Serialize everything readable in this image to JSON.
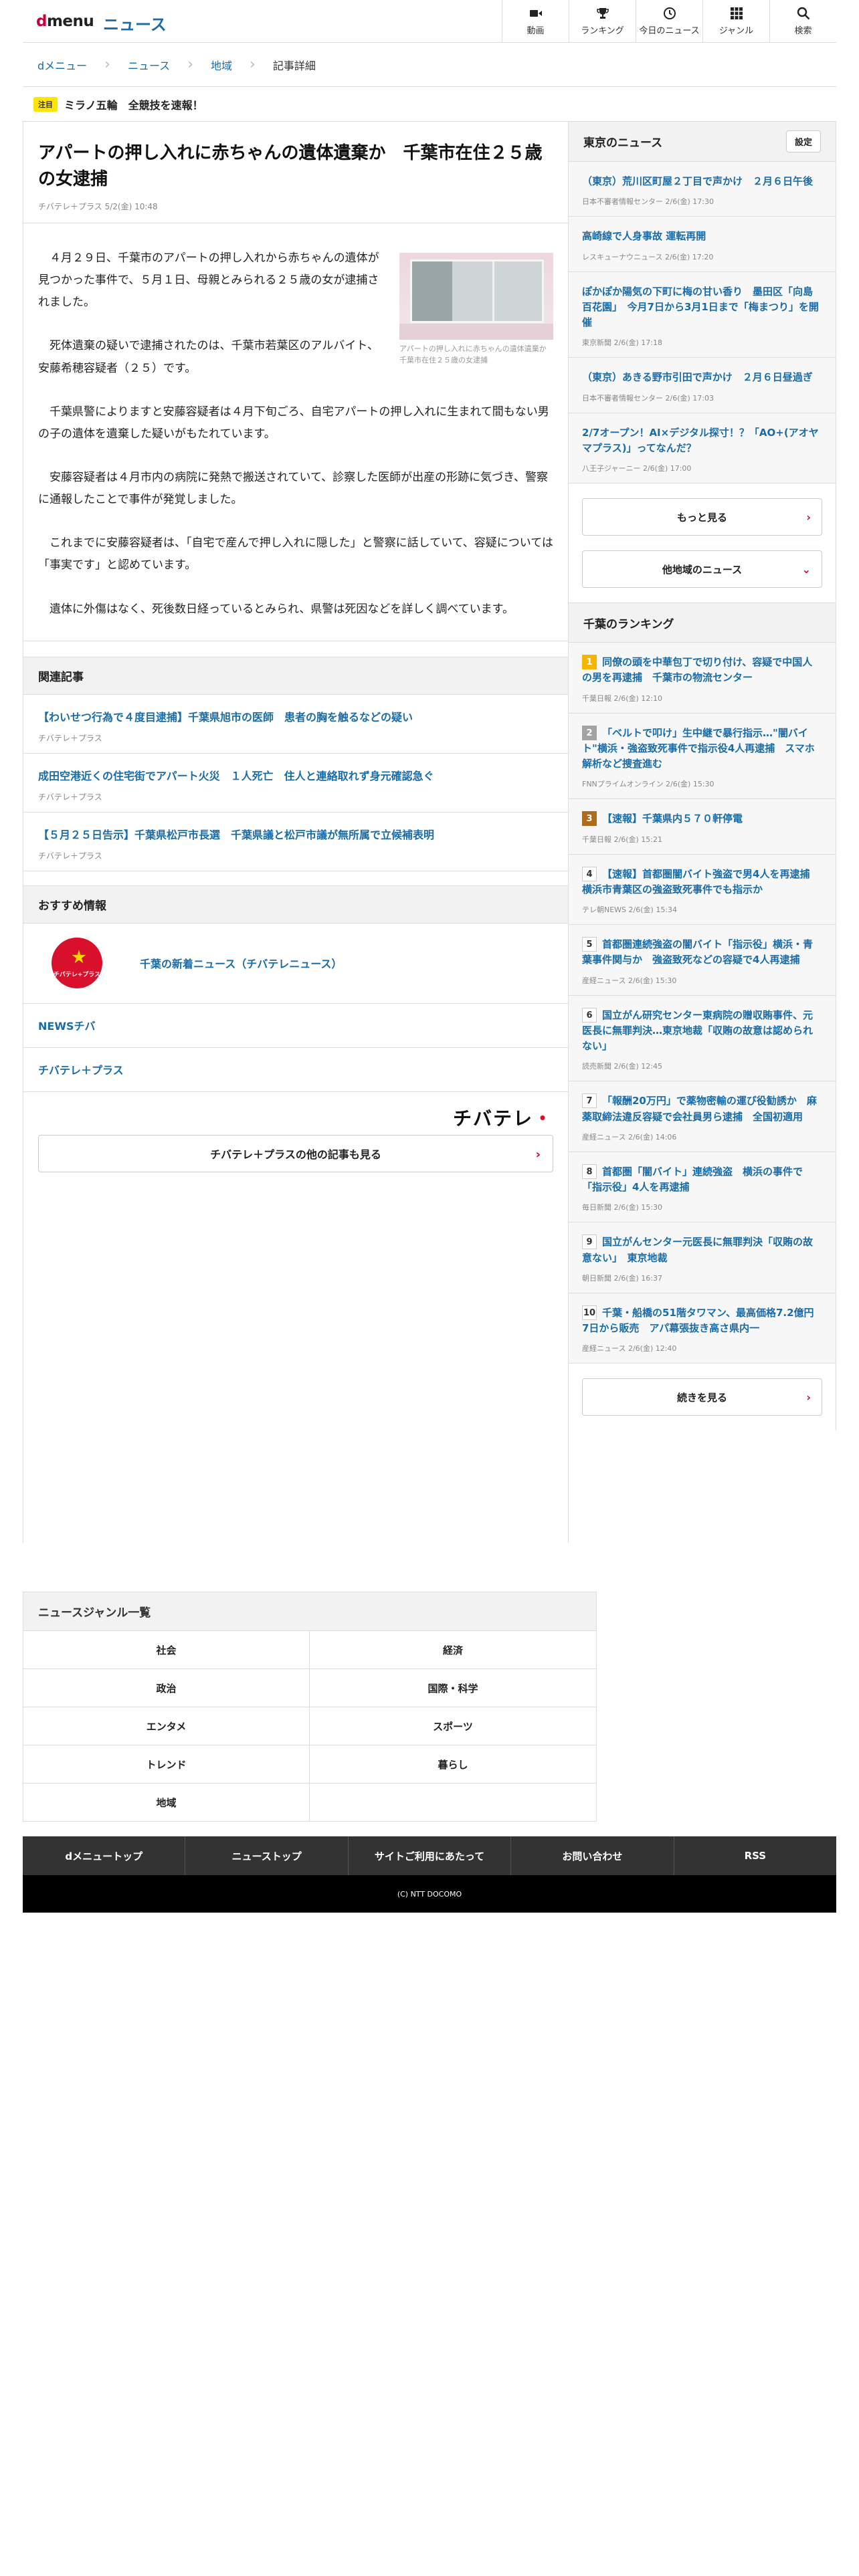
{
  "header": {
    "logo_text": "dmenu",
    "section": "ニュース",
    "nav": [
      {
        "icon": "video-camera-icon",
        "label": "動画"
      },
      {
        "icon": "trophy-icon",
        "label": "ランキング"
      },
      {
        "icon": "clock-icon",
        "label": "今日のニュース"
      },
      {
        "icon": "grid-icon",
        "label": "ジャンル"
      },
      {
        "icon": "search-icon",
        "label": "検索"
      }
    ]
  },
  "breadcrumb": [
    "dメニュー",
    "ニュース",
    "地域",
    "記事詳細"
  ],
  "notice": {
    "badge": "注目",
    "text": "ミラノ五輪　全競技を速報！"
  },
  "article": {
    "title": "アパートの押し入れに赤ちゃんの遺体遺棄か　千葉市在住２５歳の女逮捕",
    "meta": "チバテレ＋プラス 5/2(金) 10:48",
    "image_caption": "アパートの押し入れに赤ちゃんの遺体遺棄か　千葉市在住２５歳の女逮捕",
    "paragraphs": [
      "４月２９日、千葉市のアパートの押し入れから赤ちゃんの遺体が見つかった事件で、５月１日、母親とみられる２５歳の女が逮捕されました。",
      "死体遺棄の疑いで逮捕されたのは、千葉市若葉区のアルバイト、安藤希穂容疑者（２５）です。",
      "千葉県警によりますと安藤容疑者は４月下旬ごろ、自宅アパートの押し入れに生まれて間もない男の子の遺体を遺棄した疑いがもたれています。",
      "安藤容疑者は４月市内の病院に発熱で搬送されていて、診察した医師が出産の形跡に気づき、警察に通報したことで事件が発覚しました。",
      "これまでに安藤容疑者は、「自宅で産んで押し入れに隠した」と警察に話していて、容疑については「事実です」と認めています。",
      "遺体に外傷はなく、死後数日経っているとみられ、県警は死因などを詳しく調べています。"
    ]
  },
  "related": {
    "heading": "関連記事",
    "items": [
      {
        "title": "【わいせつ行為で４度目逮捕】千葉県旭市の医師　患者の胸を触るなどの疑い",
        "source": "チバテレ＋プラス"
      },
      {
        "title": "成田空港近くの住宅街でアパート火災　１人死亡　住人と連絡取れず身元確認急ぐ",
        "source": "チバテレ＋プラス"
      },
      {
        "title": "【５月２５日告示】千葉県松戸市長選　千葉県議と松戸市議が無所属で立候補表明",
        "source": "チバテレ＋プラス"
      }
    ]
  },
  "recommend": {
    "heading": "おすすめ情報",
    "logo_text": "チバテレ+プラス",
    "featured": "千葉の新着ニュース（チバテレニュース）",
    "items": [
      "NEWSチバ",
      "チバテレ＋プラス"
    ],
    "brand": "チバテレ",
    "more": "チバテレ＋プラスの他の記事も見る"
  },
  "tokyo": {
    "heading": "東京のニュース",
    "setting": "設定",
    "items": [
      {
        "title": "（東京）荒川区町屋２丁目で声かけ　２月６日午後",
        "source": "日本不審者情報センター 2/6(金) 17:30"
      },
      {
        "title": "高崎線で人身事故 運転再開",
        "source": "レスキューナウニュース 2/6(金) 17:20"
      },
      {
        "title": "ぽかぽか陽気の下町に梅の甘い香り　墨田区「向島百花園」　今月7日から3月1日まで「梅まつり」を開催",
        "source": "東京新聞 2/6(金) 17:18"
      },
      {
        "title": "（東京）あきる野市引田で声かけ　２月６日昼過ぎ",
        "source": "日本不審者情報センター 2/6(金) 17:03"
      },
      {
        "title": "2/7オープン！AI×デジタル探寸！？「AO+(アオヤマプラス)」ってなんだ？",
        "source": "八王子ジャーニー 2/6(金) 17:00"
      }
    ],
    "more": "もっと見る",
    "other": "他地域のニュース"
  },
  "ranking": {
    "heading": "千葉のランキング",
    "items": [
      {
        "rank": "1",
        "title": "同僚の頭を中華包丁で切り付け、容疑で中国人の男を再逮捕　千葉市の物流センター",
        "source": "千葉日報 2/6(金) 12:10"
      },
      {
        "rank": "2",
        "title": "「ベルトで叩け」生中継で暴行指示…\"闇バイト\"横浜・強盗致死事件で指示役4人再逮捕　スマホ解析など捜査進む",
        "source": "FNNプライムオンライン 2/6(金) 15:30"
      },
      {
        "rank": "3",
        "title": "【速報】千葉県内５７０軒停電",
        "source": "千葉日報 2/6(金) 15:21"
      },
      {
        "rank": "4",
        "title": "【速報】首都圏闇バイト強盗で男4人を再逮捕　横浜市青葉区の強盗致死事件でも指示か",
        "source": "テレ朝NEWS 2/6(金) 15:34"
      },
      {
        "rank": "5",
        "title": "首都圏連続強盗の闇バイト「指示役」横浜・青葉事件関与か　強盗致死などの容疑で4人再逮捕",
        "source": "産経ニュース 2/6(金) 15:30"
      },
      {
        "rank": "6",
        "title": "国立がん研究センター東病院の贈収賄事件、元医長に無罪判決…東京地裁「収賄の故意は認められない」",
        "source": "読売新聞 2/6(金) 12:45"
      },
      {
        "rank": "7",
        "title": "「報酬20万円」で薬物密輸の運び役勧誘か　麻薬取締法違反容疑で会社員男ら逮捕　全国初適用",
        "source": "産経ニュース 2/6(金) 14:06"
      },
      {
        "rank": "8",
        "title": "首都圏「闇バイト」連続強盗　横浜の事件で「指示役」4人を再逮捕",
        "source": "毎日新聞 2/6(金) 15:30"
      },
      {
        "rank": "9",
        "title": "国立がんセンター元医長に無罪判決「収賄の故意ない」　東京地裁",
        "source": "朝日新聞 2/6(金) 16:37"
      },
      {
        "rank": "10",
        "title": "千葉・船橋の51階タワマン、最高価格7.2億円　7日から販売　アパ幕張抜き高さ県内一",
        "source": "産経ニュース 2/6(金) 12:40"
      }
    ],
    "more": "続きを見る"
  },
  "genre": {
    "heading": "ニュースジャンル一覧",
    "rows": [
      [
        "社会",
        "経済"
      ],
      [
        "政治",
        "国際・科学"
      ],
      [
        "エンタメ",
        "スポーツ"
      ],
      [
        "トレンド",
        "暮らし"
      ],
      [
        "地域",
        ""
      ]
    ]
  },
  "footer": {
    "nav": [
      "dメニュートップ",
      "ニューストップ",
      "サイトご利用にあたって",
      "お問い合わせ",
      "RSS"
    ],
    "copyright": "(C) NTT DOCOMO"
  },
  "colors": {
    "brand": "#c8003b",
    "link": "#1a6ca8",
    "badge": "#ffe500",
    "footer": "#333333"
  }
}
